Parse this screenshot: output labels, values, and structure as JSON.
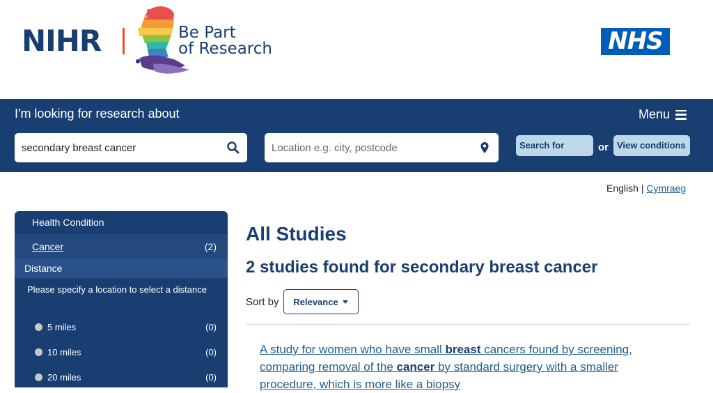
{
  "header": {
    "org_name": "NIHR",
    "service_line1": "Be Part",
    "service_line2": "of Research",
    "nhs_label": "NHS"
  },
  "search": {
    "title": "I'm looking for research about",
    "menu_label": "Menu",
    "query_value": "secondary breast cancer",
    "location_placeholder": "Location e.g. city, postcode",
    "search_button": "Search for study",
    "or_label": "or",
    "view_button": "View conditions"
  },
  "language": {
    "current": "English",
    "separator": "|",
    "alternate": "Cymraeg"
  },
  "filters": {
    "health_heading": "Health Condition",
    "condition_name": "Cancer",
    "condition_count": "(2)",
    "distance_heading": "Distance",
    "distance_note": "Please specify a location to select a distance",
    "options": [
      {
        "label": "5 miles",
        "count": "(0)"
      },
      {
        "label": "10 miles",
        "count": "(0)"
      },
      {
        "label": "20 miles",
        "count": "(0)"
      }
    ]
  },
  "results": {
    "heading": "All Studies",
    "summary": "2 studies found for secondary breast cancer",
    "sort_label": "Sort by",
    "sort_value": "Relevance",
    "first": {
      "p1": "A study for women who have small ",
      "b1": "breast",
      "p2": " cancers found by screening, comparing removal of the ",
      "b2": "cancer",
      "p3": " by standard surgery with a smaller procedure, which is more like a biopsy"
    }
  },
  "colors": {
    "navy": "#193e72",
    "button_bg": "#bed8ea",
    "nhs_blue": "#005eb8",
    "link": "#1f5d8c"
  }
}
